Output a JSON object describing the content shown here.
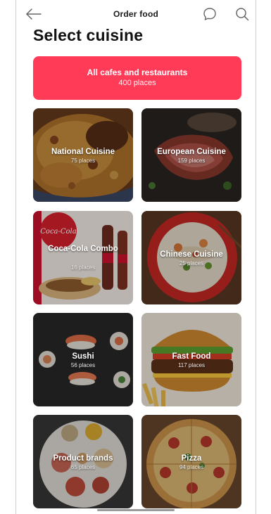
{
  "header": {
    "title": "Order food",
    "back_icon": "arrow-left-icon",
    "chat_icon": "chat-bubble-icon",
    "search_icon": "search-icon"
  },
  "page": {
    "heading": "Select cuisine"
  },
  "all_places": {
    "label": "All cafes and restaurants",
    "count": "400 places",
    "color": "#ff3b58"
  },
  "categories": [
    {
      "name": "National Cuisine",
      "count": "75 places"
    },
    {
      "name": "European Cuisine",
      "count": "159 places"
    },
    {
      "name": "Coca-Cola Combo",
      "count": "16 places"
    },
    {
      "name": "Chinese Cuisine",
      "count": "25 places"
    },
    {
      "name": "Sushi",
      "count": "56 places"
    },
    {
      "name": "Fast Food",
      "count": "117 places"
    },
    {
      "name": "Product brands",
      "count": "65 places"
    },
    {
      "name": "Pizza",
      "count": "94 places"
    }
  ],
  "photo_text": {
    "coca_cola_logo": "Coca-Cola"
  }
}
